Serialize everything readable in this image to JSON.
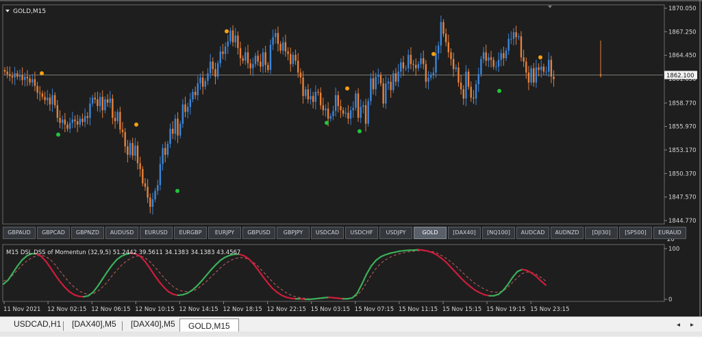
{
  "chart_title": "GOLD,M15",
  "indicator_title": "M15 DSL DSS of Momentun (32,9,5) 51.2442 39.5611 34.1383 34.1383 43.4567",
  "price_axis": {
    "ticks": [
      "1870.050",
      "1867.250",
      "1864.450",
      "1861.650",
      "1858.770",
      "1855.970",
      "1853.170",
      "1850.370",
      "1847.570",
      "1844.770"
    ],
    "current_price": "1862.100",
    "current_price_value": 1862.1,
    "range": [
      1844.77,
      1870.05
    ]
  },
  "indicator_axis": {
    "ticks": [
      "100",
      "0"
    ],
    "panel_divider_labels": [
      "100",
      "20"
    ]
  },
  "time_axis": [
    "11 Nov 2021",
    "12 Nov 02:15",
    "12 Nov 06:15",
    "12 Nov 10:15",
    "12 Nov 14:15",
    "12 Nov 18:15",
    "12 Nov 22:15",
    "15 Nov 03:15",
    "15 Nov 07:15",
    "15 Nov 11:15",
    "15 Nov 15:15",
    "15 Nov 19:15",
    "15 Nov 23:15"
  ],
  "symbol_buttons": [
    "GBPAUD",
    "GBPCAD",
    "GBPNZD",
    "AUDUSD",
    "EURUSD",
    "EURGBP",
    "EURJPY",
    "GBPUSD",
    "GBPJPY",
    "USDCAD",
    "USDCHF",
    "USDJPY",
    "GOLD",
    "[DAX40]",
    "[NQ100]",
    "AUDCAD",
    "AUDNZD",
    "[DJI30]",
    "[SP500]",
    "EURAUD"
  ],
  "active_symbol": "GOLD",
  "tabs": [
    "USDCAD,H1",
    "[DAX40],M5",
    "[DAX40],M5",
    "GOLD,M15"
  ],
  "active_tab": "GOLD,M15",
  "colors": {
    "bull": "#3d86d9",
    "bear": "#e8813a",
    "dot_up": "#22c43a",
    "dot_down": "#f5a010",
    "osc_up": "#3cb05a",
    "osc_down": "#d01c3c",
    "background": "#1e1e1e"
  },
  "chart_data": {
    "type": "candlestick",
    "ylim": [
      1844.77,
      1870.05
    ],
    "closes": [
      1862.5,
      1862.2,
      1862.0,
      1861.8,
      1862.3,
      1861.9,
      1862.1,
      1861.5,
      1861.9,
      1861.7,
      1861.2,
      1861.6,
      1860.8,
      1860.0,
      1859.9,
      1859.5,
      1859.1,
      1859.4,
      1858.6,
      1859.7,
      1858.5,
      1857.0,
      1856.4,
      1856.8,
      1856.2,
      1855.7,
      1856.4,
      1856.8,
      1856.6,
      1856.2,
      1856.9,
      1856.5,
      1857.2,
      1857.0,
      1858.7,
      1859.4,
      1859.2,
      1858.4,
      1859.5,
      1857.9,
      1859.2,
      1858.8,
      1859.3,
      1857.0,
      1856.6,
      1857.7,
      1855.6,
      1855.3,
      1853.6,
      1852.6,
      1854.0,
      1852.5,
      1853.7,
      1851.6,
      1850.9,
      1849.2,
      1848.8,
      1847.5,
      1846.4,
      1847.3,
      1848.3,
      1849.0,
      1851.5,
      1853.4,
      1852.6,
      1853.9,
      1855.7,
      1855.1,
      1856.9,
      1854.9,
      1856.3,
      1858.6,
      1857.7,
      1858.3,
      1859.2,
      1860.1,
      1859.7,
      1861.1,
      1861.8,
      1860.7,
      1861.4,
      1862.3,
      1863.7,
      1862.8,
      1861.9,
      1863.5,
      1864.9,
      1864.6,
      1865.5,
      1866.1,
      1867.4,
      1866.0,
      1866.8,
      1865.3,
      1864.1,
      1863.8,
      1864.8,
      1863.5,
      1862.9,
      1863.4,
      1864.4,
      1863.7,
      1863.1,
      1864.8,
      1863.3,
      1862.7,
      1865.7,
      1866.6,
      1867.1,
      1865.8,
      1865.0,
      1866.0,
      1864.9,
      1864.6,
      1863.4,
      1864.5,
      1863.8,
      1862.4,
      1861.8,
      1859.6,
      1860.4,
      1859.2,
      1859.6,
      1858.9,
      1860.1,
      1860.0,
      1858.5,
      1857.9,
      1858.1,
      1856.9,
      1857.2,
      1857.8,
      1859.7,
      1858.4,
      1857.9,
      1857.5,
      1857.6,
      1856.9,
      1857.9,
      1858.2,
      1859.9,
      1857.0,
      1858.3,
      1858.5,
      1856.3,
      1859.0,
      1861.7,
      1860.4,
      1861.9,
      1862.1,
      1861.1,
      1858.7,
      1861.1,
      1861.3,
      1860.3,
      1862.3,
      1861.3,
      1862.5,
      1863.6,
      1862.9,
      1862.9,
      1864.5,
      1863.4,
      1863.3,
      1862.9,
      1863.4,
      1864.1,
      1863.4,
      1861.3,
      1861.8,
      1862.1,
      1862.4,
      1864.7,
      1865.6,
      1868.4,
      1867.0,
      1866.0,
      1864.8,
      1864.0,
      1862.8,
      1863.0,
      1861.2,
      1860.4,
      1859.3,
      1862.5,
      1860.7,
      1859.4,
      1859.3,
      1861.0,
      1862.2,
      1864.0,
      1864.8,
      1863.8,
      1864.2,
      1863.9,
      1863.1,
      1863.1,
      1863.9,
      1864.7,
      1864.1,
      1865.0,
      1866.4,
      1866.4,
      1867.2,
      1866.6,
      1866.7,
      1864.2,
      1863.7,
      1862.4,
      1861.2,
      1862.9,
      1861.2,
      1863.0,
      1862.7,
      1863.1,
      1862.5,
      1862.5,
      1863.9,
      1861.9,
      1861.6
    ],
    "up_dots": [
      [
        13,
        1855.0
      ],
      [
        42,
        1848.3
      ],
      [
        75,
        1856.4
      ],
      [
        83,
        1855.4
      ],
      [
        117,
        1860.2
      ]
    ],
    "down_dots": [
      [
        9,
        1862.3
      ],
      [
        32,
        1856.2
      ],
      [
        54,
        1867.3
      ],
      [
        80,
        1860.5
      ],
      [
        101,
        1864.6
      ],
      [
        127,
        1864.2
      ]
    ],
    "forming_bar": {
      "open": 1863.8,
      "high": 1864.0,
      "low": 1861.8,
      "close": 1862.1
    },
    "indicator": {
      "type": "line",
      "ylim": [
        0,
        100
      ],
      "main": [
        30,
        38,
        52,
        66,
        78,
        86,
        90,
        90,
        85,
        75,
        62,
        48,
        35,
        24,
        15,
        9,
        6,
        5,
        7,
        14,
        26,
        40,
        54,
        67,
        78,
        85,
        89,
        91,
        90,
        85,
        75,
        62,
        48,
        35,
        24,
        15,
        10,
        8,
        9,
        12,
        18,
        26,
        36,
        47,
        58,
        68,
        77,
        83,
        87,
        89,
        89,
        86,
        80,
        70,
        58,
        45,
        33,
        22,
        14,
        8,
        4,
        2,
        1,
        1,
        0,
        0,
        1,
        2,
        3,
        4,
        3,
        2,
        1,
        1,
        3,
        12,
        30,
        50,
        66,
        77,
        84,
        88,
        91,
        93,
        95,
        96,
        97,
        97,
        98,
        97,
        95,
        92,
        87,
        80,
        72,
        62,
        52,
        42,
        33,
        25,
        18,
        13,
        9,
        7,
        7,
        10,
        18,
        30,
        44,
        55,
        59,
        57,
        52,
        45,
        36,
        28
      ],
      "signal": [
        36,
        40,
        48,
        58,
        68,
        76,
        82,
        86,
        87,
        84,
        78,
        68,
        56,
        44,
        33,
        24,
        17,
        12,
        10,
        11,
        16,
        24,
        34,
        46,
        57,
        67,
        75,
        81,
        85,
        86,
        82,
        75,
        65,
        54,
        43,
        33,
        25,
        19,
        16,
        15,
        16,
        20,
        27,
        35,
        44,
        53,
        62,
        70,
        76,
        80,
        82,
        82,
        79,
        73,
        65,
        55,
        45,
        35,
        26,
        19,
        13,
        8,
        5,
        3,
        2,
        1,
        1,
        1,
        2,
        3,
        3,
        3,
        2,
        2,
        3,
        8,
        18,
        33,
        48,
        61,
        71,
        78,
        83,
        87,
        90,
        92,
        94,
        95,
        96,
        96,
        95,
        94,
        91,
        86,
        80,
        73,
        65,
        56,
        47,
        39,
        31,
        25,
        20,
        16,
        14,
        14,
        17,
        24,
        34,
        43,
        51,
        54,
        53,
        49,
        43,
        36
      ]
    }
  }
}
